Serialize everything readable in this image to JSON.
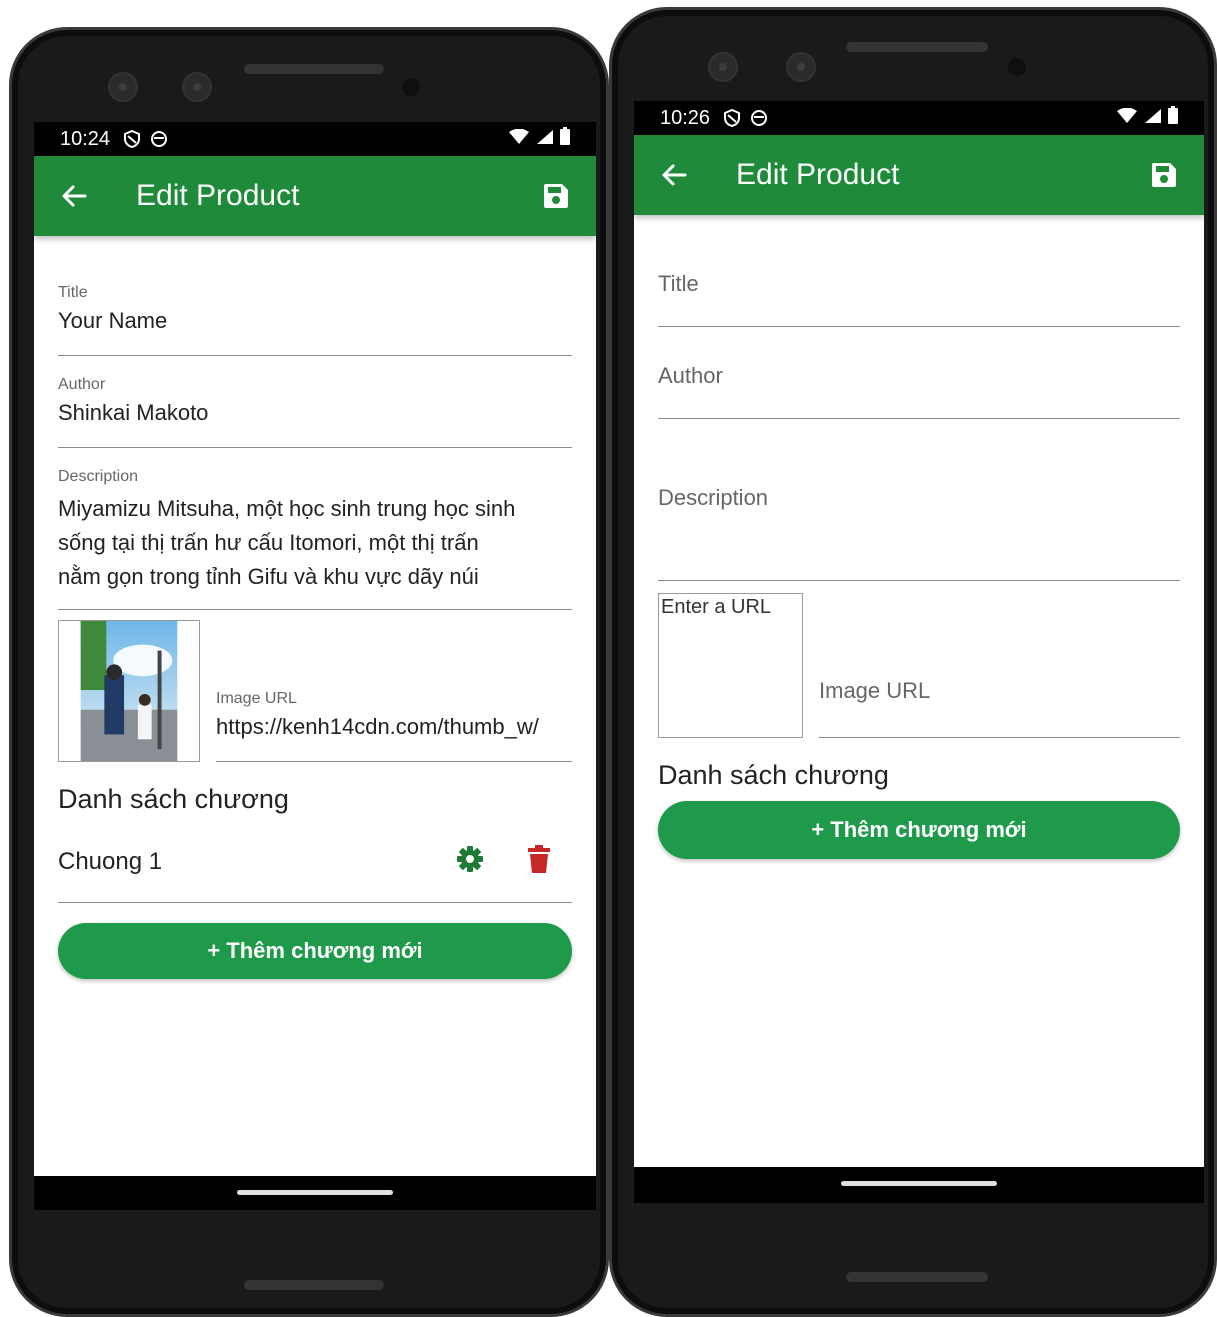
{
  "screens": [
    {
      "status": {
        "time": "10:24"
      },
      "appbar": {
        "title": "Edit Product"
      },
      "form": {
        "title_label": "Title",
        "title_value": "Your Name",
        "author_label": "Author",
        "author_value": "Shinkai Makoto",
        "description_label": "Description",
        "description_lines": [
          "Miyamizu Mitsuha, một học sinh trung học sinh",
          "sống tại thị trấn hư cấu Itomori, một thị trấn",
          "nằm gọn trong tỉnh Gifu và khu vực dãy núi"
        ],
        "image_url_label": "Image URL",
        "image_url_value": "https://kenh14cdn.com/thumb_w/"
      },
      "chapters_heading": "Danh sách chương",
      "chapters": [
        {
          "name": "Chuong 1"
        }
      ],
      "add_chapter_label": "+ Thêm chương mới",
      "colors": {
        "edit_icon": "#1e7a34",
        "delete_icon": "#c62828"
      }
    },
    {
      "status": {
        "time": "10:26"
      },
      "appbar": {
        "title": "Edit Product"
      },
      "form": {
        "title_label": "Title",
        "author_label": "Author",
        "description_label": "Description",
        "image_placeholder": "Enter a URL",
        "image_url_label": "Image URL"
      },
      "chapters_heading": "Danh sách chương",
      "add_chapter_label": "+ Thêm chương mới"
    }
  ],
  "colors": {
    "appbar": "#1e8a3a",
    "button": "#1f9a4a"
  },
  "icons": [
    "back-arrow-icon",
    "save-icon",
    "gear-icon",
    "trash-icon",
    "wifi-icon",
    "signal-icon",
    "battery-icon",
    "shield-icon",
    "sync-icon"
  ]
}
